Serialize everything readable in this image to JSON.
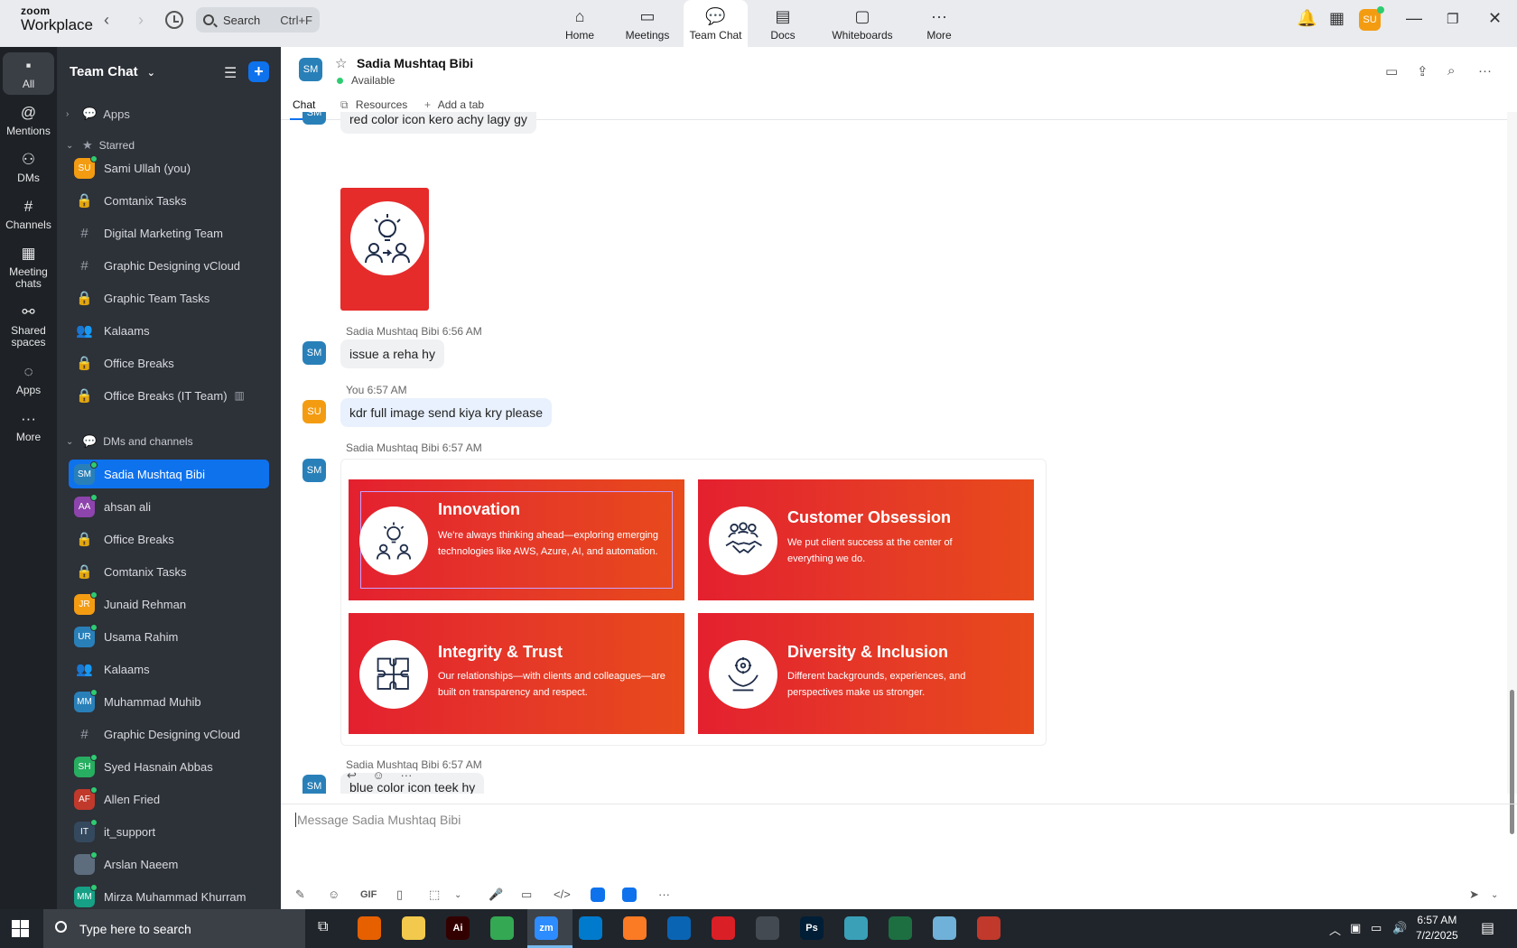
{
  "app": {
    "logo_top": "zoom",
    "logo_bottom": "Workplace"
  },
  "topbar": {
    "search": {
      "label": "Search",
      "shortcut": "Ctrl+F"
    },
    "tabs": [
      {
        "label": "Home",
        "icon": "home-icon"
      },
      {
        "label": "Meetings",
        "icon": "video-icon"
      },
      {
        "label": "Team Chat",
        "icon": "chat-icon"
      },
      {
        "label": "Docs",
        "icon": "doc-icon"
      },
      {
        "label": "Whiteboards",
        "icon": "whiteboard-icon"
      },
      {
        "label": "More",
        "icon": "more-icon"
      }
    ],
    "avatar": "SU"
  },
  "rail": {
    "items": [
      {
        "label": "All",
        "icon": "chat-bubble-icon"
      },
      {
        "label": "Mentions",
        "icon": "at-icon"
      },
      {
        "label": "DMs",
        "icon": "people-icon"
      },
      {
        "label": "Channels",
        "icon": "hash-icon"
      },
      {
        "label": "Meeting chats",
        "icon": "calendar-icon"
      },
      {
        "label": "Shared spaces",
        "icon": "share-icon"
      },
      {
        "label": "Apps",
        "icon": "apps-icon"
      },
      {
        "label": "More",
        "icon": "more-icon"
      }
    ]
  },
  "sidebar": {
    "title": "Team Chat",
    "apps_label": "Apps",
    "starred_label": "Starred",
    "starred": [
      {
        "label": "Sami Ullah (you)",
        "type": "avatar",
        "initials": "SU",
        "color": "#f39c12"
      },
      {
        "label": "Comtanix Tasks",
        "type": "lock"
      },
      {
        "label": "Digital Marketing Team",
        "type": "hash"
      },
      {
        "label": "Graphic Designing vCloud",
        "type": "hash"
      },
      {
        "label": "Graphic Team Tasks",
        "type": "lock"
      },
      {
        "label": "Kalaams",
        "type": "group"
      },
      {
        "label": "Office Breaks",
        "type": "lock"
      },
      {
        "label": "Office Breaks (IT Team)",
        "type": "lock"
      }
    ],
    "dms_label": "DMs and channels",
    "dms": [
      {
        "label": "Sadia Mushtaq Bibi",
        "type": "avatar",
        "initials": "SM",
        "color": "#2980b9"
      },
      {
        "label": "ahsan ali",
        "type": "avatar",
        "initials": "AA",
        "color": "#8e44ad"
      },
      {
        "label": "Office Breaks",
        "type": "lock"
      },
      {
        "label": "Comtanix Tasks",
        "type": "lock"
      },
      {
        "label": "Junaid Rehman",
        "type": "avatar",
        "initials": "JR",
        "color": "#f39c12"
      },
      {
        "label": "Usama Rahim",
        "type": "avatar",
        "initials": "UR",
        "color": "#2980b9"
      },
      {
        "label": "Kalaams",
        "type": "group"
      },
      {
        "label": "Muhammad Muhib",
        "type": "avatar",
        "initials": "MM",
        "color": "#2980b9"
      },
      {
        "label": "Graphic Designing vCloud",
        "type": "hash"
      },
      {
        "label": "Syed Hasnain Abbas",
        "type": "avatar",
        "initials": "SH",
        "color": "#27ae60"
      },
      {
        "label": "Allen Fried",
        "type": "avatar",
        "initials": "AF",
        "color": "#c0392b"
      },
      {
        "label": "it_support",
        "type": "avatar",
        "initials": "IT",
        "color": "#34495e"
      },
      {
        "label": "Arslan Naeem",
        "type": "avatar",
        "initials": "",
        "color": "#5d6d7e"
      },
      {
        "label": "Mirza Muhammad Khurram",
        "type": "avatar",
        "initials": "MM",
        "color": "#16a085"
      }
    ]
  },
  "chat_header": {
    "initials": "SM",
    "name": "Sadia Mushtaq Bibi",
    "status": "Available",
    "tabs": {
      "chat": "Chat",
      "resources": "Resources",
      "add": "Add a tab"
    }
  },
  "messages": {
    "m0_text": "red color icon kero achy lagy gy",
    "m0_initials": "SM",
    "m1_sender": "Sadia Mushtaq Bibi",
    "m1_time": "6:56 AM",
    "m1_text": "issue a reha hy",
    "m1_initials": "SM",
    "m2_sender": "You",
    "m2_time": "6:57 AM",
    "m2_text": "kdr full image send kiya kry please",
    "m2_initials": "SU",
    "m3_sender": "Sadia Mushtaq Bibi",
    "m3_time": "6:57 AM",
    "m3_initials": "SM",
    "m4_sender": "Sadia Mushtaq Bibi",
    "m4_time": "6:57 AM",
    "m4_text": "blue color icon teek hy",
    "m4_initials": "SM"
  },
  "values_image": [
    {
      "title": "Innovation",
      "desc": "We're always thinking ahead—exploring emerging technologies like AWS, Azure, AI, and automation."
    },
    {
      "title": "Customer Obsession",
      "desc": "We put client success at the center of everything we do."
    },
    {
      "title": "Integrity & Trust",
      "desc": "Our relationships—with clients and colleagues—are built on transparency and respect."
    },
    {
      "title": "Diversity & Inclusion",
      "desc": "Different backgrounds, experiences, and perspectives make us stronger."
    }
  ],
  "composer": {
    "placeholder": "Message Sadia Mushtaq Bibi",
    "gif_label": "GIF"
  },
  "taskbar": {
    "search_placeholder": "Type here to search",
    "time": "6:57 AM",
    "date": "7/2/2025",
    "apps": [
      {
        "label": "",
        "icon": "firefox-icon",
        "color": "#e66000"
      },
      {
        "label": "",
        "icon": "folder-icon",
        "color": "#f2c94c"
      },
      {
        "label": "Ai",
        "icon": "illustrator-icon",
        "color": "#330000"
      },
      {
        "label": "",
        "icon": "chrome-icon",
        "color": "#34a853"
      },
      {
        "label": "zm",
        "icon": "zoom-icon",
        "color": "#2d8cff"
      },
      {
        "label": "",
        "icon": "vscode-icon",
        "color": "#007acc"
      },
      {
        "label": "",
        "icon": "xampp-icon",
        "color": "#fb7a24"
      },
      {
        "label": "",
        "icon": "outlook-icon",
        "color": "#0a64b4"
      },
      {
        "label": "",
        "icon": "creative-cloud-icon",
        "color": "#da1f26"
      },
      {
        "label": "",
        "icon": "pen-icon",
        "color": "#444a52"
      },
      {
        "label": "Ps",
        "icon": "photoshop-icon",
        "color": "#001e36"
      },
      {
        "label": "",
        "icon": "app-icon",
        "color": "#3aa0b8"
      },
      {
        "label": "",
        "icon": "excel-icon",
        "color": "#1d6f42"
      },
      {
        "label": "",
        "icon": "notepad-icon",
        "color": "#6fb1d8"
      },
      {
        "label": "",
        "icon": "snipping-icon",
        "color": "#c0392b"
      }
    ]
  }
}
